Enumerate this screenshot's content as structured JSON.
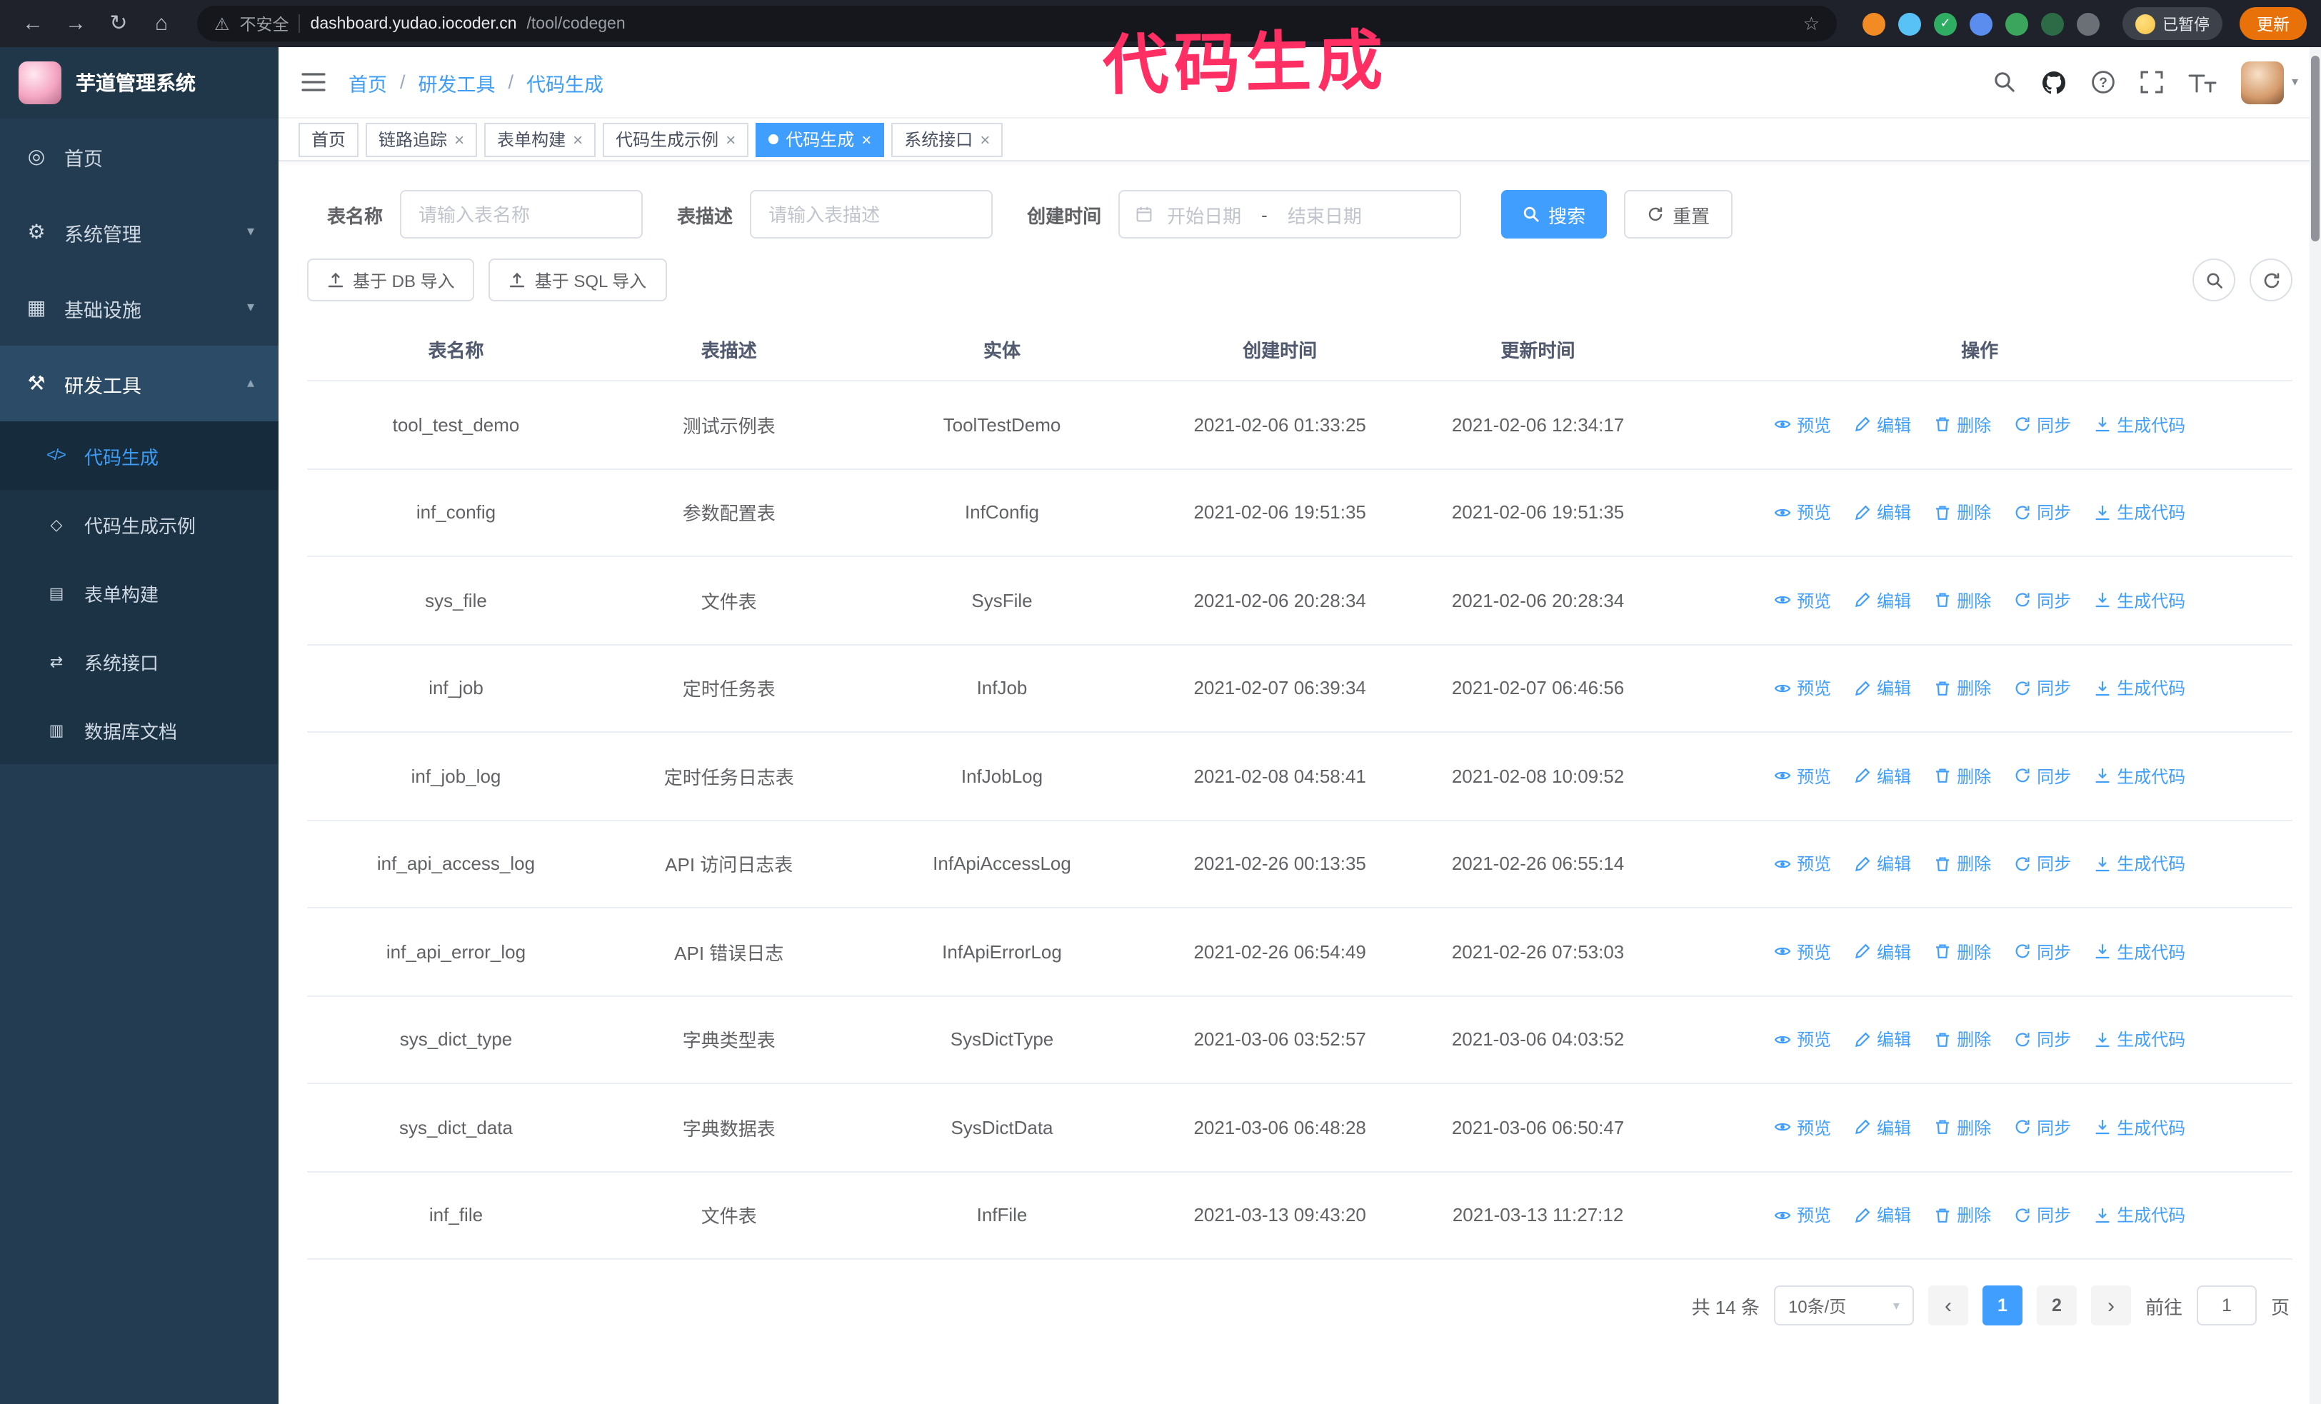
{
  "colors": {
    "primary": "#409eff",
    "annotation": "#ff2e63",
    "sidebar_bg": "#233c51",
    "submenu_bg": "#1c3345",
    "chrome_bg": "#1f222a",
    "update_button_bg": "#e8710a",
    "active_tab_bg": "#409eff"
  },
  "icons": {
    "back": "←",
    "forward": "→",
    "reload": "↻",
    "home": "⌂",
    "warning": "⚠",
    "star": "☆",
    "menu_home": "◎",
    "menu_system": "⚙",
    "menu_infra": "▦",
    "menu_tools": "⚒",
    "sub_codegen": "</>",
    "sub_example": "◇",
    "sub_form": "▤",
    "sub_api": "⇄",
    "sub_dbdoc": "▥",
    "chevron_down": "▾",
    "chevron_up": "▴",
    "caret": "▾",
    "close": "×",
    "crumb_sep": "/",
    "prev": "‹",
    "next": "›",
    "check": "✓"
  },
  "browser": {
    "security_label": "不安全",
    "url_host": "dashboard.yudao.iocoder.cn",
    "url_path": "/tool/codegen",
    "paused_badge": "已暂停",
    "update_button": "更新"
  },
  "annotation": {
    "text": "代码生成"
  },
  "sidebar": {
    "logo_title": "芋道管理系统",
    "items": [
      {
        "label": "首页"
      },
      {
        "label": "系统管理"
      },
      {
        "label": "基础设施"
      },
      {
        "label": "研发工具"
      }
    ],
    "submenu": [
      {
        "label": "代码生成"
      },
      {
        "label": "代码生成示例"
      },
      {
        "label": "表单构建"
      },
      {
        "label": "系统接口"
      },
      {
        "label": "数据库文档"
      }
    ]
  },
  "header": {
    "breadcrumb": [
      "首页",
      "研发工具",
      "代码生成"
    ]
  },
  "tabs": [
    {
      "label": "首页"
    },
    {
      "label": "链路追踪"
    },
    {
      "label": "表单构建"
    },
    {
      "label": "代码生成示例"
    },
    {
      "label": "代码生成"
    },
    {
      "label": "系统接口"
    }
  ],
  "filters": {
    "table_name_label": "表名称",
    "table_name_placeholder": "请输入表名称",
    "table_desc_label": "表描述",
    "table_desc_placeholder": "请输入表描述",
    "create_time_label": "创建时间",
    "date_start_placeholder": "开始日期",
    "date_separator": "-",
    "date_end_placeholder": "结束日期",
    "search_button": "搜索",
    "reset_button": "重置"
  },
  "toolbar": {
    "import_db_button": "基于 DB 导入",
    "import_sql_button": "基于 SQL 导入"
  },
  "table": {
    "columns": [
      "表名称",
      "表描述",
      "实体",
      "创建时间",
      "更新时间",
      "操作"
    ],
    "actions": [
      "预览",
      "编辑",
      "删除",
      "同步",
      "生成代码"
    ],
    "rows": [
      {
        "name": "tool_test_demo",
        "desc": "测试示例表",
        "entity": "ToolTestDemo",
        "created": "2021-02-06 01:33:25",
        "updated": "2021-02-06 12:34:17"
      },
      {
        "name": "inf_config",
        "desc": "参数配置表",
        "entity": "InfConfig",
        "created": "2021-02-06 19:51:35",
        "updated": "2021-02-06 19:51:35"
      },
      {
        "name": "sys_file",
        "desc": "文件表",
        "entity": "SysFile",
        "created": "2021-02-06 20:28:34",
        "updated": "2021-02-06 20:28:34"
      },
      {
        "name": "inf_job",
        "desc": "定时任务表",
        "entity": "InfJob",
        "created": "2021-02-07 06:39:34",
        "updated": "2021-02-07 06:46:56"
      },
      {
        "name": "inf_job_log",
        "desc": "定时任务日志表",
        "entity": "InfJobLog",
        "created": "2021-02-08 04:58:41",
        "updated": "2021-02-08 10:09:52"
      },
      {
        "name": "inf_api_access_log",
        "desc": "API 访问日志表",
        "entity": "InfApiAccessLog",
        "created": "2021-02-26 00:13:35",
        "updated": "2021-02-26 06:55:14"
      },
      {
        "name": "inf_api_error_log",
        "desc": "API 错误日志",
        "entity": "InfApiErrorLog",
        "created": "2021-02-26 06:54:49",
        "updated": "2021-02-26 07:53:03"
      },
      {
        "name": "sys_dict_type",
        "desc": "字典类型表",
        "entity": "SysDictType",
        "created": "2021-03-06 03:52:57",
        "updated": "2021-03-06 04:03:52"
      },
      {
        "name": "sys_dict_data",
        "desc": "字典数据表",
        "entity": "SysDictData",
        "created": "2021-03-06 06:48:28",
        "updated": "2021-03-06 06:50:47"
      },
      {
        "name": "inf_file",
        "desc": "文件表",
        "entity": "InfFile",
        "created": "2021-03-13 09:43:20",
        "updated": "2021-03-13 11:27:12"
      }
    ]
  },
  "pagination": {
    "total": "共 14 条",
    "page_size": "10条/页",
    "pages": [
      "1",
      "2"
    ],
    "active_page": "1",
    "goto_prefix": "前往",
    "goto_value": "1",
    "goto_suffix": "页"
  }
}
